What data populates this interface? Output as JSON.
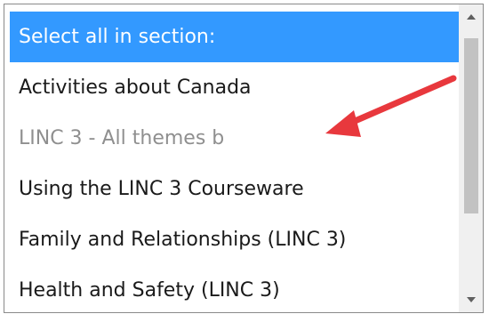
{
  "listbox": {
    "items": [
      {
        "label": "Select all in section:",
        "state": "selected"
      },
      {
        "label": "Activities about Canada",
        "state": "normal"
      },
      {
        "label": "LINC 3 - All themes b",
        "state": "disabled"
      },
      {
        "label": "Using the LINC 3 Courseware",
        "state": "normal"
      },
      {
        "label": "Family and Relationships (LINC 3)",
        "state": "normal"
      },
      {
        "label": "Health and Safety (LINC 3)",
        "state": "normal"
      }
    ]
  },
  "scrollbar": {
    "up_icon": "chevron-up-icon",
    "down_icon": "chevron-down-icon"
  },
  "annotation": {
    "icon": "red-arrow-icon",
    "color": "#e8383d"
  },
  "colors": {
    "selection": "#3399ff",
    "disabled_text": "#8f8f8f"
  }
}
